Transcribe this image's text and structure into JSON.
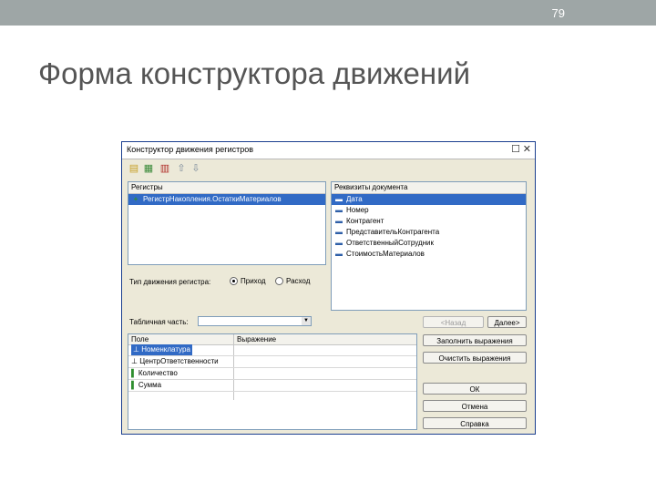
{
  "slide": {
    "number": "79",
    "title": "Форма конструктора движений"
  },
  "window": {
    "title": "Конструктор движения регистров",
    "maximize_glyph": "☐",
    "close_glyph": "✕"
  },
  "toolbar": {
    "icons": [
      "add-register-icon",
      "add-row-icon",
      "delete-icon",
      "move-up-icon",
      "move-down-icon"
    ]
  },
  "registers": {
    "header": "Регистры",
    "items": [
      {
        "label": "РегистрНакопления.ОстаткиМатериалов",
        "selected": true
      }
    ]
  },
  "movement_type": {
    "label": "Тип движения регистра:",
    "options": [
      "Приход",
      "Расход"
    ],
    "selected": "Приход"
  },
  "requisites": {
    "header": "Реквизиты документа",
    "items": [
      {
        "label": "Дата",
        "selected": true
      },
      {
        "label": "Номер",
        "selected": false
      },
      {
        "label": "Контрагент",
        "selected": false
      },
      {
        "label": "ПредставительКонтрагента",
        "selected": false
      },
      {
        "label": "ОтветственныйСотрудник",
        "selected": false
      },
      {
        "label": "СтоимостьМатериалов",
        "selected": false
      }
    ]
  },
  "tabular": {
    "label": "Табличная часть:",
    "value": ""
  },
  "fields_grid": {
    "columns": [
      "Поле",
      "Выражение"
    ],
    "rows": [
      {
        "field": "Номенклатура",
        "icon": "dimension",
        "selected": true
      },
      {
        "field": "ЦентрОтветственности",
        "icon": "dimension",
        "selected": false
      },
      {
        "field": "Количество",
        "icon": "resource",
        "selected": false
      },
      {
        "field": "Сумма",
        "icon": "resource",
        "selected": false
      }
    ]
  },
  "buttons": {
    "back": "<Назад",
    "next": "Далее>",
    "fill": "Заполнить выражения",
    "clear": "Очистить выражения",
    "ok": "ОК",
    "cancel": "Отмена",
    "help": "Справка"
  },
  "colors": {
    "topbar": "#9ea6a6",
    "selection": "#316ac5",
    "dialog_bg": "#ece9d8"
  }
}
